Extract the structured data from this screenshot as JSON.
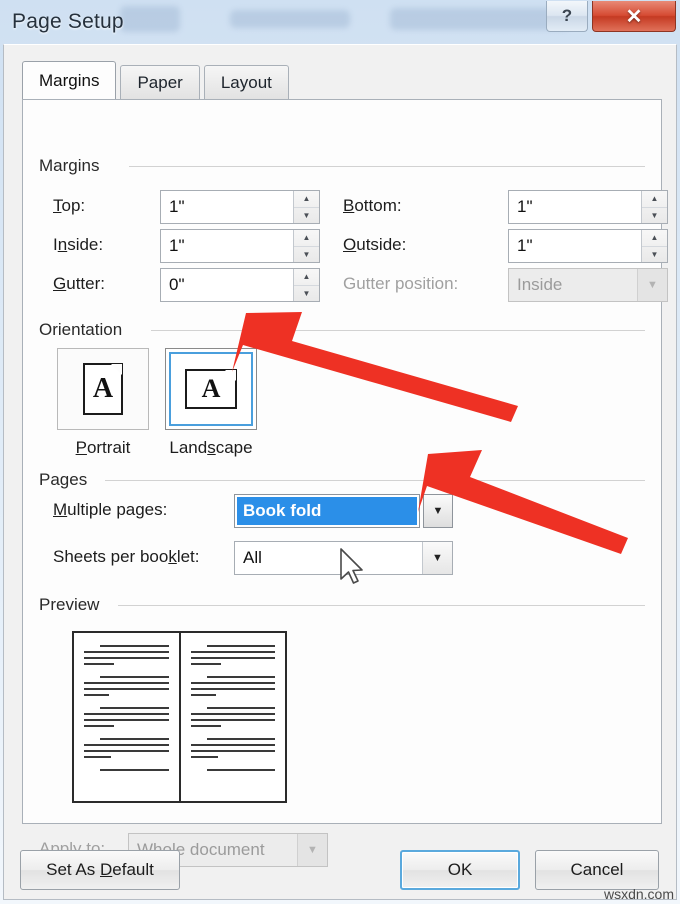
{
  "window": {
    "title": "Page Setup",
    "help_button": "?",
    "close_button": "✕"
  },
  "tabs": [
    {
      "label": "Margins",
      "active": true
    },
    {
      "label": "Paper",
      "active": false
    },
    {
      "label": "Layout",
      "active": false
    }
  ],
  "margins_group": {
    "title": "Margins",
    "fields": [
      {
        "label": "Top:",
        "accel": "T",
        "value": "1\"",
        "disabled": false
      },
      {
        "label": "Bottom:",
        "accel": "B",
        "value": "1\"",
        "disabled": false
      },
      {
        "label": "Inside:",
        "accel": "n",
        "value": "1\"",
        "disabled": false
      },
      {
        "label": "Outside:",
        "accel": "O",
        "value": "1\"",
        "disabled": false
      },
      {
        "label": "Gutter:",
        "accel": "G",
        "value": "0\"",
        "disabled": false
      }
    ],
    "gutter_position": {
      "label": "Gutter position:",
      "value": "Inside",
      "disabled": true
    }
  },
  "orientation_group": {
    "title": "Orientation",
    "portrait": {
      "label": "Portrait",
      "accel": "P",
      "selected": false,
      "glyph": "A"
    },
    "landscape": {
      "label": "Landscape",
      "accel": "s",
      "selected": true,
      "glyph": "A"
    }
  },
  "pages_group": {
    "title": "Pages",
    "multiple_pages": {
      "label": "Multiple pages:",
      "accel": "M",
      "value": "Book fold",
      "highlighted": true
    },
    "sheets_per_booklet": {
      "label": "Sheets per booklet:",
      "accel": "k",
      "value": "All"
    }
  },
  "preview_group": {
    "title": "Preview",
    "pages": 2,
    "paragraphs_per_page": 4
  },
  "apply_to": {
    "label": "Apply to:",
    "value": "Whole document",
    "disabled": true
  },
  "buttons": {
    "set_as_default": "Set As Default",
    "set_as_default_accel": "D",
    "ok": "OK",
    "cancel": "Cancel"
  },
  "annotations": {
    "arrow_landscape": "red-arrow-pointing-to-landscape",
    "arrow_multiple_pages": "red-arrow-pointing-to-multiple-pages",
    "arrow_color": "#EE3124"
  },
  "watermark": "wsxdn.com"
}
